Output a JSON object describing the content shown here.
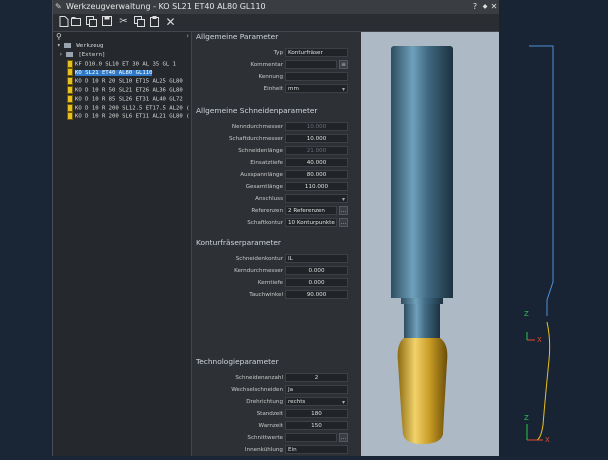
{
  "window": {
    "title": "Werkzeugverwaltung - KO  SL21 ET40 AL80 GL110",
    "help_label": "?",
    "restore_label": "◆",
    "close_label": "✕"
  },
  "tree": {
    "root_label": "Werkzeug",
    "extern_label": "[Extern]",
    "items": [
      {
        "label": "KF D10.0 SL10    ET 30    AL 35 GL 1"
      },
      {
        "label": "KO  SL21 ET40 AL80 GL110"
      },
      {
        "label": "KO D 10 R  20 SL10 ET15 AL25 GL80"
      },
      {
        "label": "KO D 10 R  50 SL21 ET26 AL36 GL80"
      },
      {
        "label": "KO D 10 R  85 SL26 ET31 AL40 GL72"
      },
      {
        "label": "KO D 10 R 200 SL12.5 ET17.5 AL20 ("
      },
      {
        "label": "KO D 10 R 200 SL6 ET11 AL21 GL80 ("
      }
    ]
  },
  "params": {
    "allgemein": {
      "title": "Allgemeine Parameter",
      "typ_label": "Typ",
      "typ_value": "Konturfräser",
      "kommentar_label": "Kommentar",
      "kommentar_value": "",
      "kennung_label": "Kennung",
      "kennung_value": "",
      "einheit_label": "Einheit",
      "einheit_value": "mm"
    },
    "schneiden": {
      "title": "Allgemeine Schneidenparameter",
      "rows": [
        {
          "label": "Nenndurchmesser",
          "value": "10.000"
        },
        {
          "label": "Schaftdurchmesser",
          "value": "10.000"
        },
        {
          "label": "Schneidenlänge",
          "value": "21.000"
        },
        {
          "label": "Einsatztiefe",
          "value": "40.000"
        },
        {
          "label": "Ausspannlänge",
          "value": "80.000"
        },
        {
          "label": "Gesamtlänge",
          "value": "110.000"
        }
      ],
      "anschluss_label": "Anschluss",
      "anschluss_value": "",
      "referenzen_label": "Referenzen",
      "referenzen_value": "2 Referenzen",
      "schaftkontur_label": "Schaftkontur",
      "schaftkontur_value": "10 Konturpunkte"
    },
    "kontur": {
      "title": "Konturfräserparameter",
      "schneidenkontur_label": "Schneidenkontur",
      "schneidenkontur_value": "IL",
      "rows": [
        {
          "label": "Kerndurchmesser",
          "value": "0.000"
        },
        {
          "label": "Kerntiefe",
          "value": "0.000"
        },
        {
          "label": "Tauchwinkel",
          "value": "90.000"
        }
      ]
    },
    "technologie": {
      "title": "Technologieparameter",
      "schneidenanzahl_label": "Schneidenanzahl",
      "schneidenanzahl_value": "2",
      "wechselschneiden_label": "Wechselschneiden",
      "wechselschneiden_value": "Ja",
      "drehrichtung_label": "Drehrichtung",
      "drehrichtung_value": "rechts",
      "standzeit_label": "Standzeit",
      "standzeit_value": "180",
      "warnzeit_label": "Warnzeit",
      "warnzeit_value": "150",
      "schnittwerte_label": "Schnittwerte",
      "schnittwerte_value": "",
      "innenkuehlung_label": "Innenkühlung",
      "innenkuehlung_value": "Ein"
    }
  },
  "axes": {
    "z_label": "Z",
    "x_label": "X"
  },
  "colors": {
    "selection": "#2f7ac8",
    "chip": "#e8c020",
    "profile_line": "#4e8fd6",
    "profile_tip": "#e8c020",
    "axis_z": "#2ec44a",
    "axis_x": "#e04a2a"
  }
}
